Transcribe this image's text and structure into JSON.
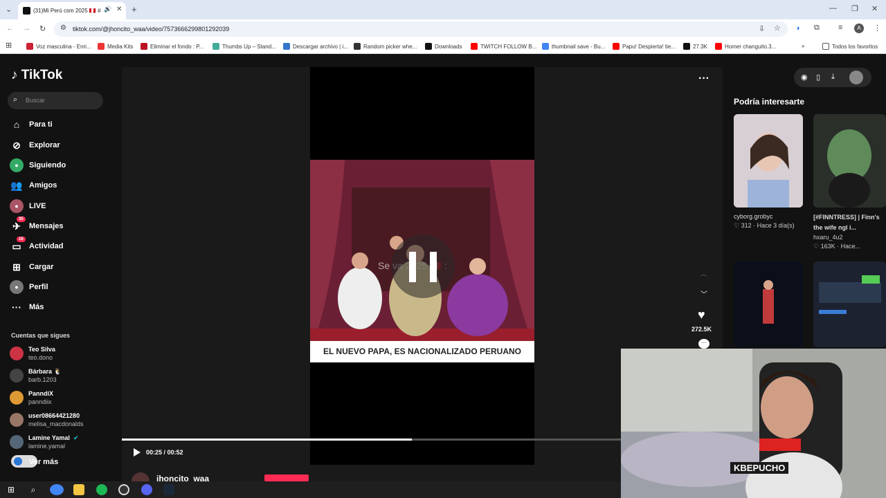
{
  "browser": {
    "tab_title": "(31)Mi Perú csm 2025 🇵🇪 #",
    "url": "tiktok.com/@jhoncito_waa/video/7573666299801292039",
    "bookmarks": [
      "Voz masculina - Enri...",
      "Media Kits",
      "Eliminar el fondo : P...",
      "Thumbs Up – Stand...",
      "Descargar archivo | i...",
      "Random picker whe...",
      "Downloads",
      "TWITCH FOLLOW B...",
      "thumbnail save - Bu...",
      "Papu! Despierta! tie...",
      "27.3K",
      "Homer changuito.3..."
    ],
    "all_bookmarks": "Todos los favoritos",
    "profile_initial": "A"
  },
  "sidebar": {
    "logo": "TikTok",
    "search_placeholder": "Buscar",
    "nav": [
      "Para ti",
      "Explorar",
      "Siguiendo",
      "Amigos",
      "LIVE",
      "Mensajes",
      "Actividad",
      "Cargar",
      "Perfil",
      "Más"
    ],
    "messages_badge": "35",
    "activity_badge": "16",
    "following_title": "Cuentas que sigues",
    "accounts": [
      {
        "name": "Teo Silva",
        "handle": "teo.dono"
      },
      {
        "name": "Bárbara 🐧",
        "handle": "barb.1203"
      },
      {
        "name": "PanndiX",
        "handle": "panndiix"
      },
      {
        "name": "user08664421280",
        "handle": "melisa_macdonalds"
      },
      {
        "name": "Lamine Yamal",
        "handle": "lamine.yamal"
      }
    ],
    "see_more": "Ver más"
  },
  "player": {
    "overlay_text": "Se va  2025 🇵🇪 :",
    "caption": "EL NUEVO PAPA, ES NACIONALIZADO PERUANO",
    "time": "00:25 / 00:52",
    "progress": 0.58,
    "likes": "272.5K",
    "username": "jhoncito_waa"
  },
  "recommendations": {
    "title": "Podría interesarte",
    "items": [
      {
        "title": "cyborg.grobyc",
        "meta": "♡ 312 · Hace 3 día(s)"
      },
      {
        "title": "[#FINNTRESS] | Finn's the wife ngl i...",
        "author": "hxaru_4u2",
        "meta": "♡ 163K · Hace..."
      }
    ]
  },
  "webcam": {
    "tag": "KBEPUCHO"
  },
  "colors": {
    "accent": "#fe2c55",
    "bg": "#121212"
  }
}
